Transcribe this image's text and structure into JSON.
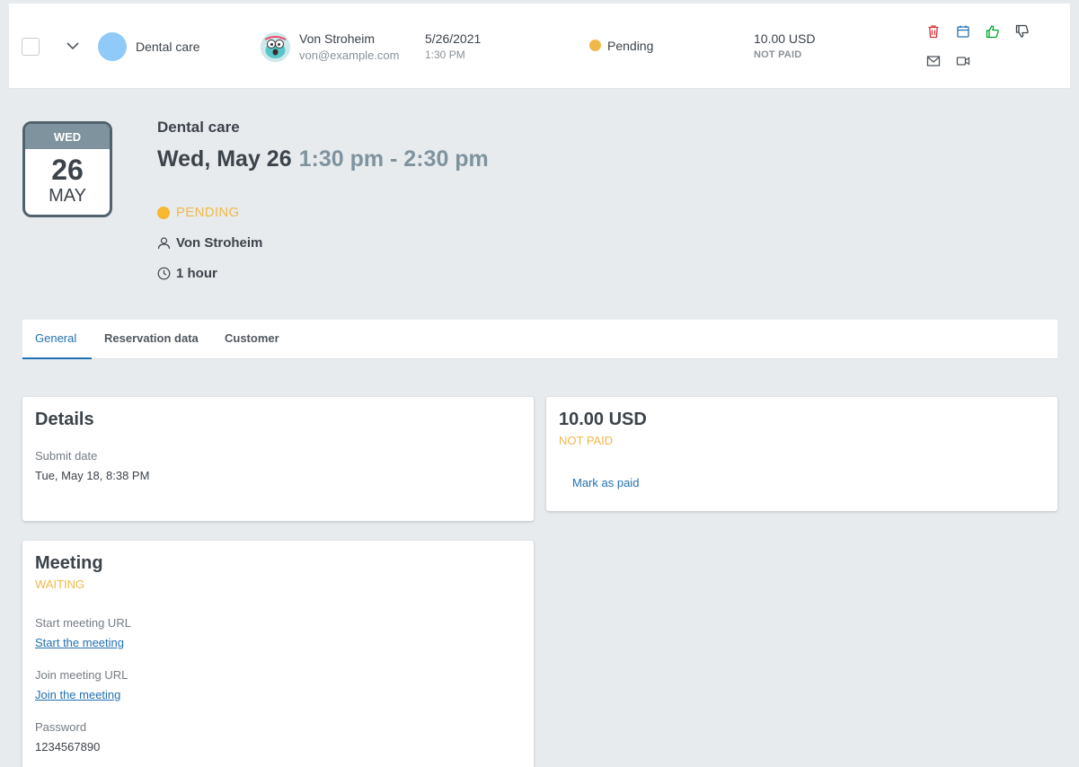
{
  "row": {
    "service": "Dental care",
    "customer_name": "Von Stroheim",
    "customer_email": "von@example.com",
    "date": "5/26/2021",
    "time": "1:30 PM",
    "status": "Pending",
    "price": "10.00 USD",
    "payment": "NOT PAID"
  },
  "calendar": {
    "weekday": "WED",
    "day": "26",
    "month": "MAY"
  },
  "header": {
    "service": "Dental care",
    "date": "Wed, May 26",
    "time_range": "1:30 pm - 2:30 pm",
    "status": "PENDING",
    "customer": "Von Stroheim",
    "duration": "1 hour"
  },
  "tabs": [
    {
      "label": "General"
    },
    {
      "label": "Reservation data"
    },
    {
      "label": "Customer"
    }
  ],
  "details": {
    "title": "Details",
    "submit_label": "Submit date",
    "submit_value": "Tue, May 18, 8:38 PM"
  },
  "payment": {
    "amount": "10.00 USD",
    "status": "NOT PAID",
    "action": "Mark as paid"
  },
  "meeting": {
    "title": "Meeting",
    "status": "WAITING",
    "start_label": "Start meeting URL",
    "start_link": "Start the meeting",
    "join_label": "Join meeting URL",
    "join_link": "Join the meeting",
    "password_label": "Password",
    "password_value": "1234567890"
  },
  "colors": {
    "accent": "#2271b1",
    "pending": "#f0b849",
    "delete": "#d63638",
    "calendar": "#2271b1",
    "approve": "#00a32a"
  }
}
